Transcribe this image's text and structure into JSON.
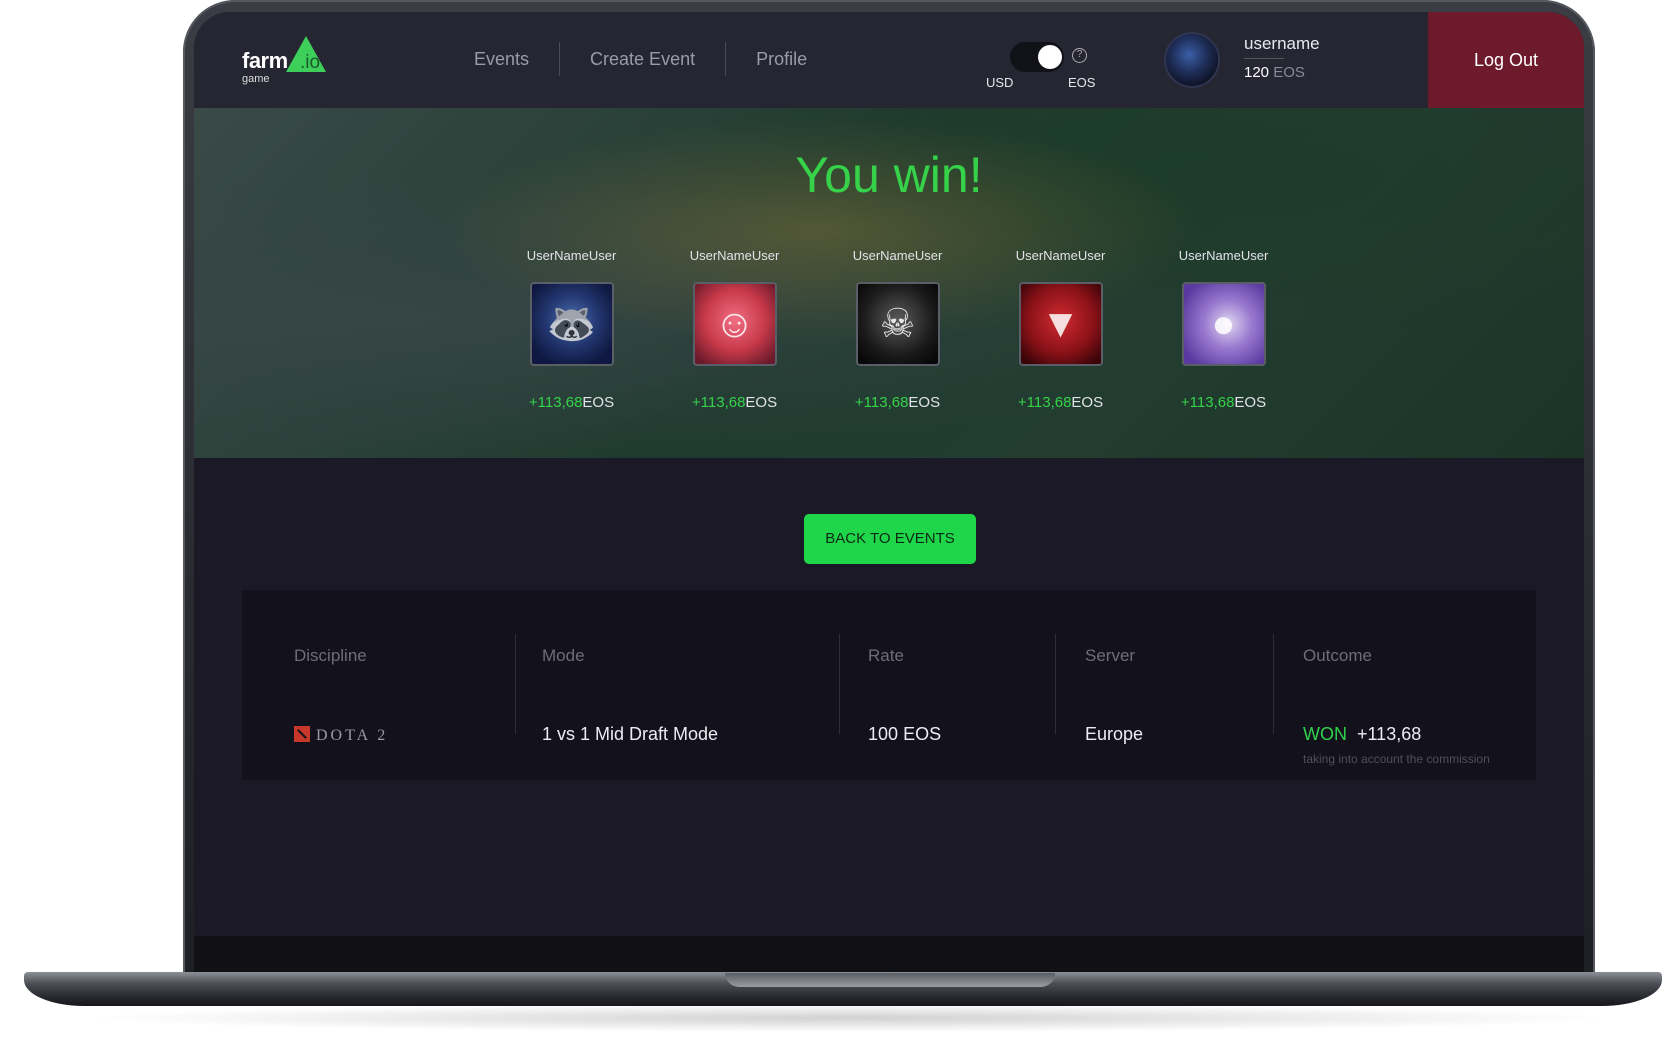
{
  "header": {
    "logo_main": "farm",
    "logo_io": ".io",
    "logo_sub": "game",
    "nav": [
      "Events",
      "Create Event",
      "Profile"
    ],
    "currency": {
      "left": "USD",
      "right": "EOS",
      "help": "?"
    },
    "user": {
      "name": "username",
      "balance_value": "120",
      "balance_unit": "EOS"
    },
    "logout_label": "Log Out"
  },
  "banner": {
    "title": "You win!",
    "players": [
      {
        "name": "UserNameUser",
        "amount": "+113,68",
        "unit": "EOS",
        "avatar_icon": "raccoon-avatar"
      },
      {
        "name": "UserNameUser",
        "amount": "+113,68",
        "unit": "EOS",
        "avatar_icon": "anime-girl-avatar"
      },
      {
        "name": "UserNameUser",
        "amount": "+113,68",
        "unit": "EOS",
        "avatar_icon": "skull-avatar"
      },
      {
        "name": "UserNameUser",
        "amount": "+113,68",
        "unit": "EOS",
        "avatar_icon": "eye-emblem-avatar"
      },
      {
        "name": "UserNameUser",
        "amount": "+113,68",
        "unit": "EOS",
        "avatar_icon": "white-hair-avatar"
      }
    ]
  },
  "back_button_label": "BACK TO EVENTS",
  "details": {
    "headers": [
      "Discipline",
      "Mode",
      "Rate",
      "Server",
      "Outcome"
    ],
    "discipline": "DOTA 2",
    "mode": "1 vs 1 Mid Draft Mode",
    "rate_value": "100",
    "rate_unit": "EOS",
    "server": "Europe",
    "outcome_status": "WON",
    "outcome_amount": "+113,68",
    "outcome_note": "taking into account the commission"
  },
  "colors": {
    "accent": "#1fd64a",
    "logout": "#6d1b2c",
    "win_text": "#35d24a"
  }
}
